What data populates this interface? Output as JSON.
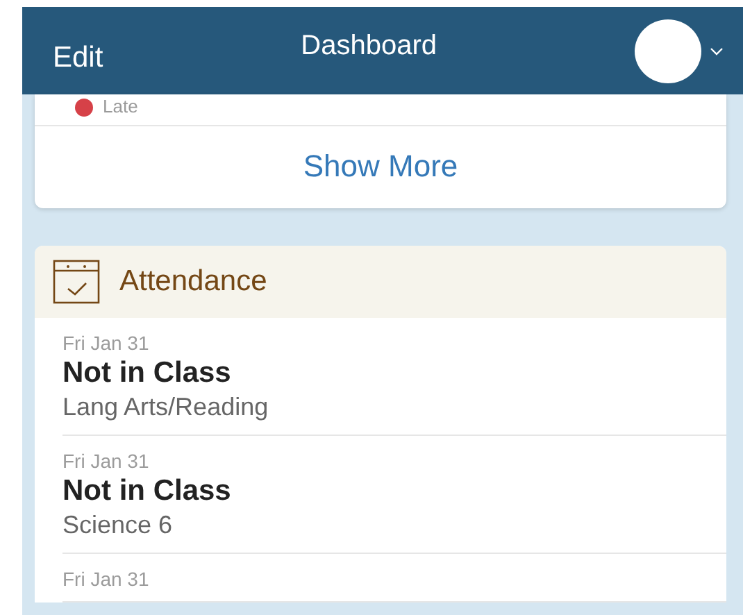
{
  "navbar": {
    "left_action": "Edit",
    "title": "Dashboard"
  },
  "summary_card": {
    "legend": [
      {
        "label": "Late",
        "color": "#d64148"
      }
    ],
    "show_more": "Show More"
  },
  "attendance": {
    "title": "Attendance",
    "items": [
      {
        "date": "Fri Jan 31",
        "status": "Not in Class",
        "subject": "Lang Arts/Reading"
      },
      {
        "date": "Fri Jan 31",
        "status": "Not in Class",
        "subject": "Science 6"
      },
      {
        "date": "Fri Jan 31"
      }
    ]
  }
}
